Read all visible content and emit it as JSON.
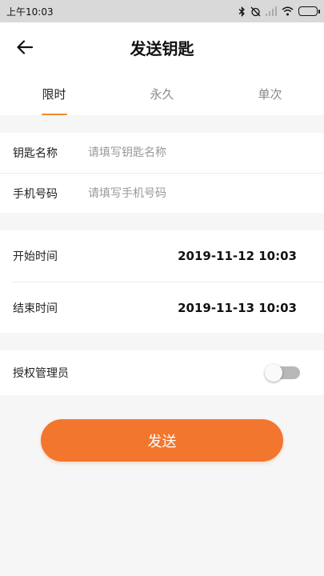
{
  "status_bar": {
    "time": "上午10:03"
  },
  "header": {
    "title": "发送钥匙"
  },
  "tabs": [
    {
      "label": "限时",
      "active": true
    },
    {
      "label": "永久",
      "active": false
    },
    {
      "label": "单次",
      "active": false
    }
  ],
  "form": {
    "key_name": {
      "label": "钥匙名称",
      "placeholder": "请填写钥匙名称"
    },
    "phone": {
      "label": "手机号码",
      "placeholder": "请填写手机号码"
    }
  },
  "times": {
    "start": {
      "label": "开始时间",
      "value": "2019-11-12 10:03"
    },
    "end": {
      "label": "结束时间",
      "value": "2019-11-13 10:03"
    }
  },
  "admin": {
    "label": "授权管理员",
    "enabled": false
  },
  "send_button": {
    "label": "发送"
  },
  "colors": {
    "accent": "#f2762e",
    "tab_indicator": "#f08a2a"
  }
}
